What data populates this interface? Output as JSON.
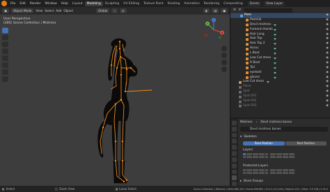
{
  "menubar": {
    "menus": [
      "File",
      "Edit",
      "Render",
      "Window",
      "Help"
    ],
    "workspaces": [
      "Layout",
      "Modeling",
      "Sculpting",
      "UV Editing",
      "Texture Paint",
      "Shading",
      "Animation",
      "Rendering",
      "Compositing"
    ],
    "active_workspace": "Modeling",
    "scene_label": "Scene",
    "view_layer_label": "View Layer"
  },
  "viewport": {
    "mode": "Object Mode",
    "menus": [
      "View",
      "Select",
      "Add",
      "Object"
    ],
    "transform": "Global",
    "info_line1": "User Perspective",
    "info_line2": "(285) Scene Collection | Mistress",
    "gizmo_axes": [
      "X",
      "Y",
      "Z"
    ]
  },
  "outliner": {
    "rows": [
      {
        "label": "Pose",
        "selected": true,
        "dim": false
      },
      {
        "label": "PoseLib",
        "selected": false,
        "dim": false
      },
      {
        "label": "Devil mistress",
        "selected": false,
        "dim": false
      },
      {
        "label": "Forearm Hands",
        "selected": false,
        "dim": false
      },
      {
        "label": "Hair Long",
        "selected": false,
        "dim": false
      },
      {
        "label": "Hair Top",
        "selected": false,
        "dim": false
      },
      {
        "label": "Hair Top 2",
        "selected": false,
        "dim": false
      },
      {
        "label": "Horns",
        "selected": false,
        "dim": false
      },
      {
        "label": "L Boot",
        "selected": false,
        "dim": false
      },
      {
        "label": "Low Cut dress",
        "selected": false,
        "dim": false
      },
      {
        "label": "R Boot",
        "selected": false,
        "dim": false
      },
      {
        "label": "Tail",
        "selected": false,
        "dim": false
      },
      {
        "label": "eyelash",
        "selected": false,
        "dim": false
      },
      {
        "label": "gloves",
        "selected": false,
        "dim": false
      },
      {
        "label": "Low Cut dress",
        "selected": false,
        "dim": false
      },
      {
        "label": "Plane",
        "selected": false,
        "dim": true
      },
      {
        "label": "Spot",
        "selected": false,
        "dim": true
      },
      {
        "label": "Spot.001",
        "selected": false,
        "dim": true
      },
      {
        "label": "Spot.002",
        "selected": false,
        "dim": true
      },
      {
        "label": "Spot.003",
        "selected": false,
        "dim": true
      }
    ]
  },
  "properties": {
    "object_name": "Mistress",
    "data_name": "Devil mistress bones",
    "armature_field": "Devil mistress bones",
    "skeleton_label": "Skeleton",
    "pose_position": "Pose Position",
    "rest_position": "Rest Position",
    "layers_label": "Layers",
    "protected_layers_label": "Protected Layers",
    "bone_groups_label": "Bone Groups"
  },
  "statusbar": {
    "select": "Select",
    "zoom_view": "Zoom View",
    "lasso_select": "Lasso Select",
    "stats": "Scene Collection | Mistress | Verts:885,105 | Faces:606,681 | Tris:1,211,028 | Objects:1/21 | Mem: 3.0 GiB | 2.92.0"
  },
  "colors": {
    "bone": "#f08a1a",
    "mesh": "#0a0a0a",
    "viewport_bg": "#3d3d3d",
    "selected_row": "#344965",
    "accent_blue": "#4772b3"
  }
}
